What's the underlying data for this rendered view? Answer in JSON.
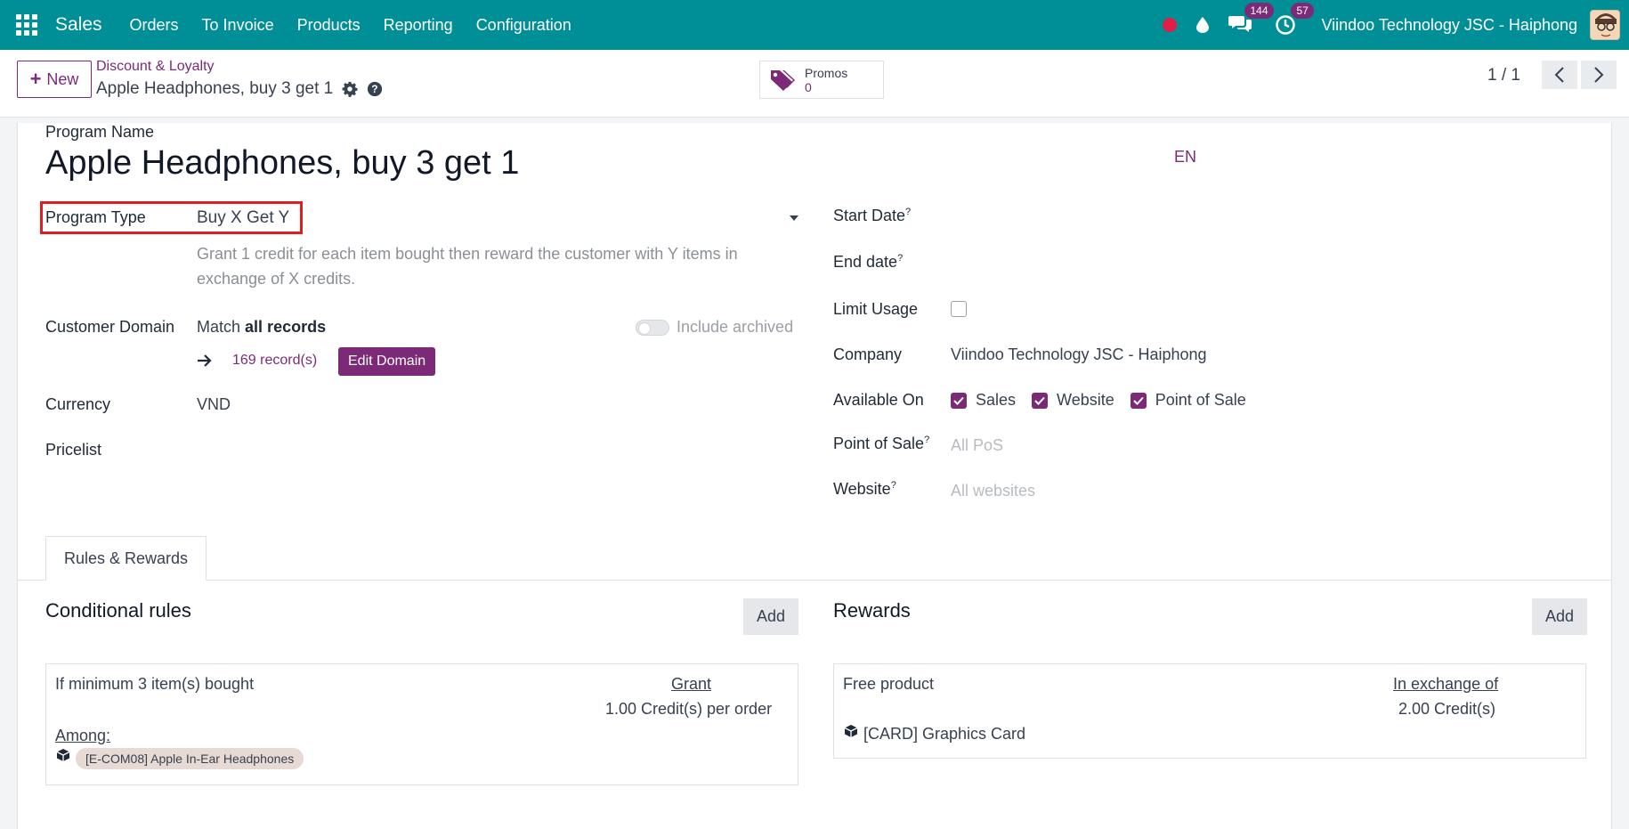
{
  "topbar": {
    "brand": "Sales",
    "menu": [
      "Orders",
      "To Invoice",
      "Products",
      "Reporting",
      "Configuration"
    ],
    "messages_count": "144",
    "activities_count": "57",
    "company": "Viindoo Technology JSC - Haiphong"
  },
  "control_panel": {
    "new_label": "New",
    "breadcrumb_parent": "Discount & Loyalty",
    "breadcrumb_current": "Apple Headphones, buy 3 get 1",
    "promos_label": "Promos",
    "promos_count": "0",
    "pager": "1 / 1"
  },
  "form": {
    "name_label": "Program Name",
    "name_value": "Apple Headphones, buy 3 get 1",
    "lang": "EN",
    "program_type_label": "Program Type",
    "program_type_value": "Buy X Get Y",
    "program_type_help": [
      "Grant 1 credit for each item bought then reward the customer with Y items in",
      "exchange of X credits."
    ],
    "customer_domain_label": "Customer Domain",
    "match_prefix": "Match",
    "match_bold": "all records",
    "include_archived": "Include archived",
    "records_link": "169 record(s)",
    "edit_domain": "Edit Domain",
    "currency_label": "Currency",
    "currency_value": "VND",
    "pricelist_label": "Pricelist",
    "start_date_label": "Start Date",
    "end_date_label": "End date",
    "limit_usage_label": "Limit Usage",
    "company_label": "Company",
    "company_value": "Viindoo Technology JSC - Haiphong",
    "available_on_label": "Available On",
    "available_on": [
      "Sales",
      "Website",
      "Point of Sale"
    ],
    "pos_label": "Point of Sale",
    "pos_placeholder": "All PoS",
    "website_label": "Website",
    "website_placeholder": "All websites",
    "help_mark": "?"
  },
  "tabs": {
    "rules_rewards": "Rules & Rewards"
  },
  "rules": {
    "title": "Conditional rules",
    "add": "Add",
    "condition": "If minimum 3 item(s) bought",
    "grant_label": "Grant",
    "grant_value": "1.00 Credit(s) per order",
    "among_label": "Among:",
    "product_chip": "[E-COM08] Apple In-Ear Headphones"
  },
  "rewards": {
    "title": "Rewards",
    "add": "Add",
    "type": "Free product",
    "exchange_label": "In exchange of",
    "exchange_value": "2.00 Credit(s)",
    "product": "[CARD] Graphics Card"
  },
  "colors": {
    "topbar": "#008f97",
    "accent": "#7c2a78",
    "highlight": "#e11d1d"
  }
}
